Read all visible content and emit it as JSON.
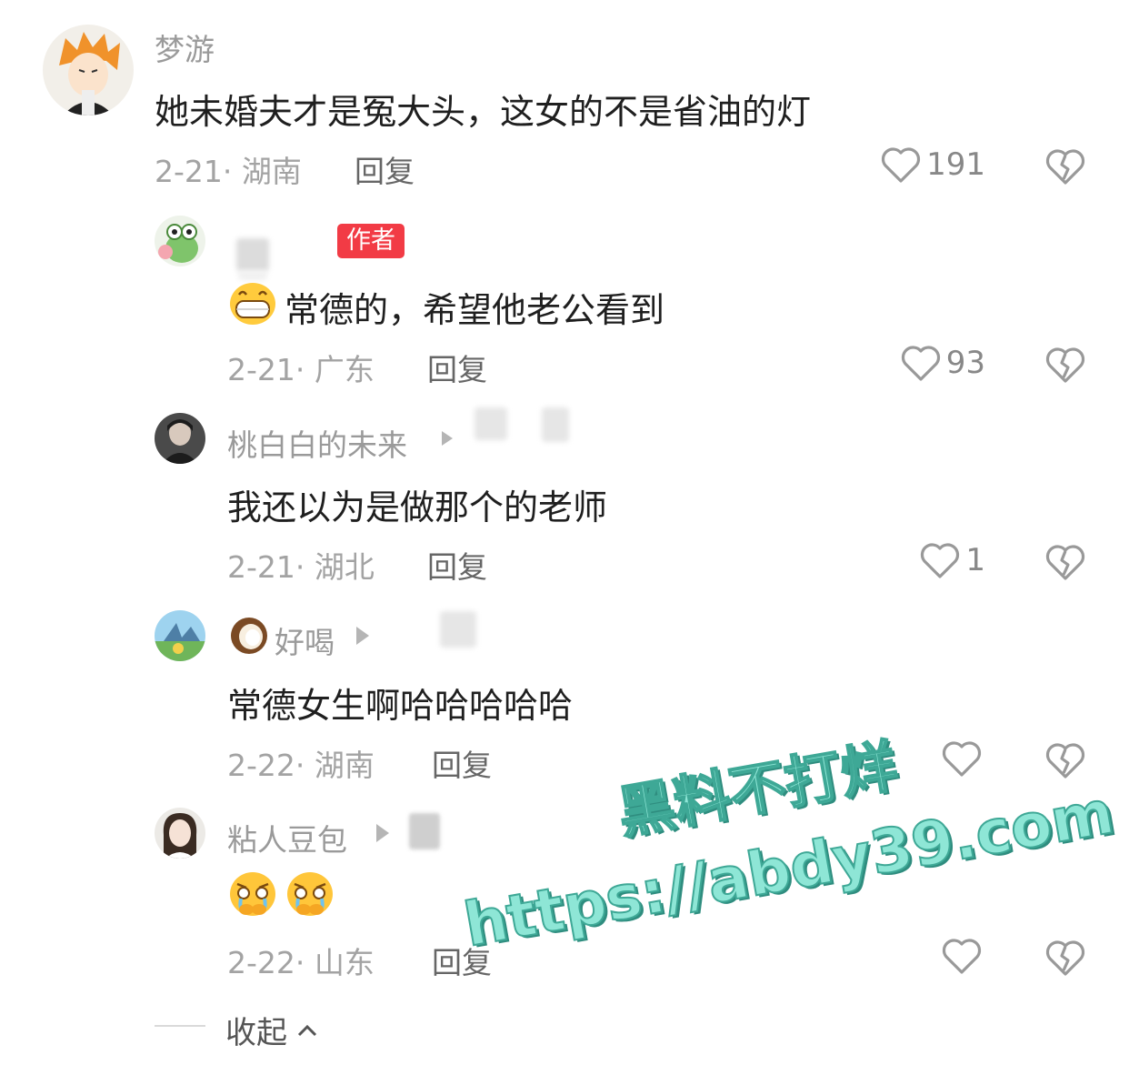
{
  "comments": [
    {
      "username": "梦游",
      "text": "她未婚夫才是冤大头，这女的不是省油的灯",
      "meta": "2-21· 湖南",
      "reply": "回复",
      "likes": "191"
    },
    {
      "username": "",
      "badge": "作者",
      "text": "常德的，希望他老公看到",
      "meta": "2-21· 广东",
      "reply": "回复",
      "likes": "93"
    },
    {
      "username": "桃白白的未来",
      "text": "我还以为是做那个的老师",
      "meta": "2-21· 湖北",
      "reply": "回复",
      "likes": "1"
    },
    {
      "username": "好喝",
      "text": "常德女生啊哈哈哈哈哈",
      "meta": "2-22· 湖南",
      "reply": "回复",
      "likes": ""
    },
    {
      "username": "粘人豆包",
      "text": "",
      "meta": "2-22· 山东",
      "reply": "回复",
      "likes": ""
    }
  ],
  "collapse_label": "收起",
  "watermark": {
    "line1": "黑料不打烊",
    "line2": "https://abdy39.com"
  },
  "icons": {
    "like": "heart-outline-icon",
    "dislike": "broken-heart-icon",
    "chevron": "chevron-up-icon"
  },
  "colors": {
    "badge": "#f23b45",
    "meta": "#a3a3a3",
    "watermark": "#8ee6d6"
  }
}
